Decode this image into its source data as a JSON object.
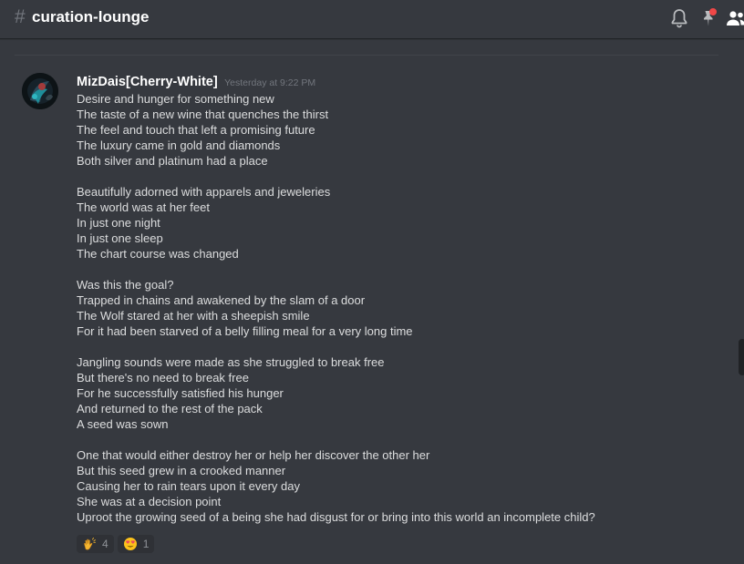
{
  "header": {
    "channel_hash": "#",
    "channel_name": "curation-lounge",
    "icons": [
      "bell-icon",
      "pin-icon",
      "members-icon"
    ],
    "pin_badge_color": "#f04747"
  },
  "message": {
    "author": "MizDais[Cherry-White]",
    "timestamp": "Yesterday at 9:22 PM",
    "avatar_icon": "avatar",
    "stanzas": [
      [
        "Desire and hunger for something new",
        "The taste of a new wine that quenches the thirst",
        "The feel and touch that left a promising future",
        "The luxury came in gold and diamonds",
        "Both silver and platinum had a place"
      ],
      [
        "Beautifully adorned with apparels and jeweleries",
        "The world was at her feet",
        "In just one night",
        "In just one sleep",
        "The chart course was changed"
      ],
      [
        "Was this the goal?",
        "Trapped in chains and awakened by the slam of a door",
        "The Wolf stared at her with a sheepish smile",
        "For it had been starved of a belly filling meal for a very long time"
      ],
      [
        "Jangling sounds were made as she struggled to break free",
        "But there's no need to break free",
        "For he successfully satisfied his hunger",
        "And returned to the rest of the pack",
        "A seed was sown"
      ],
      [
        "One that would either destroy her or help her discover the other her",
        "But this seed grew in a crooked manner",
        "Causing her to rain tears upon it every day",
        "She was at a decision point",
        "Uproot the growing seed of a being she had disgust for or bring into this world an incomplete child?"
      ]
    ],
    "reactions": [
      {
        "icon": "clapping-hands-icon",
        "count": "4"
      },
      {
        "icon": "heart-eyes-icon",
        "count": "1"
      }
    ]
  },
  "colors": {
    "background": "#36393f",
    "text": "#dcddde",
    "muted": "#72767d",
    "reaction_bg": "#2f3136"
  }
}
